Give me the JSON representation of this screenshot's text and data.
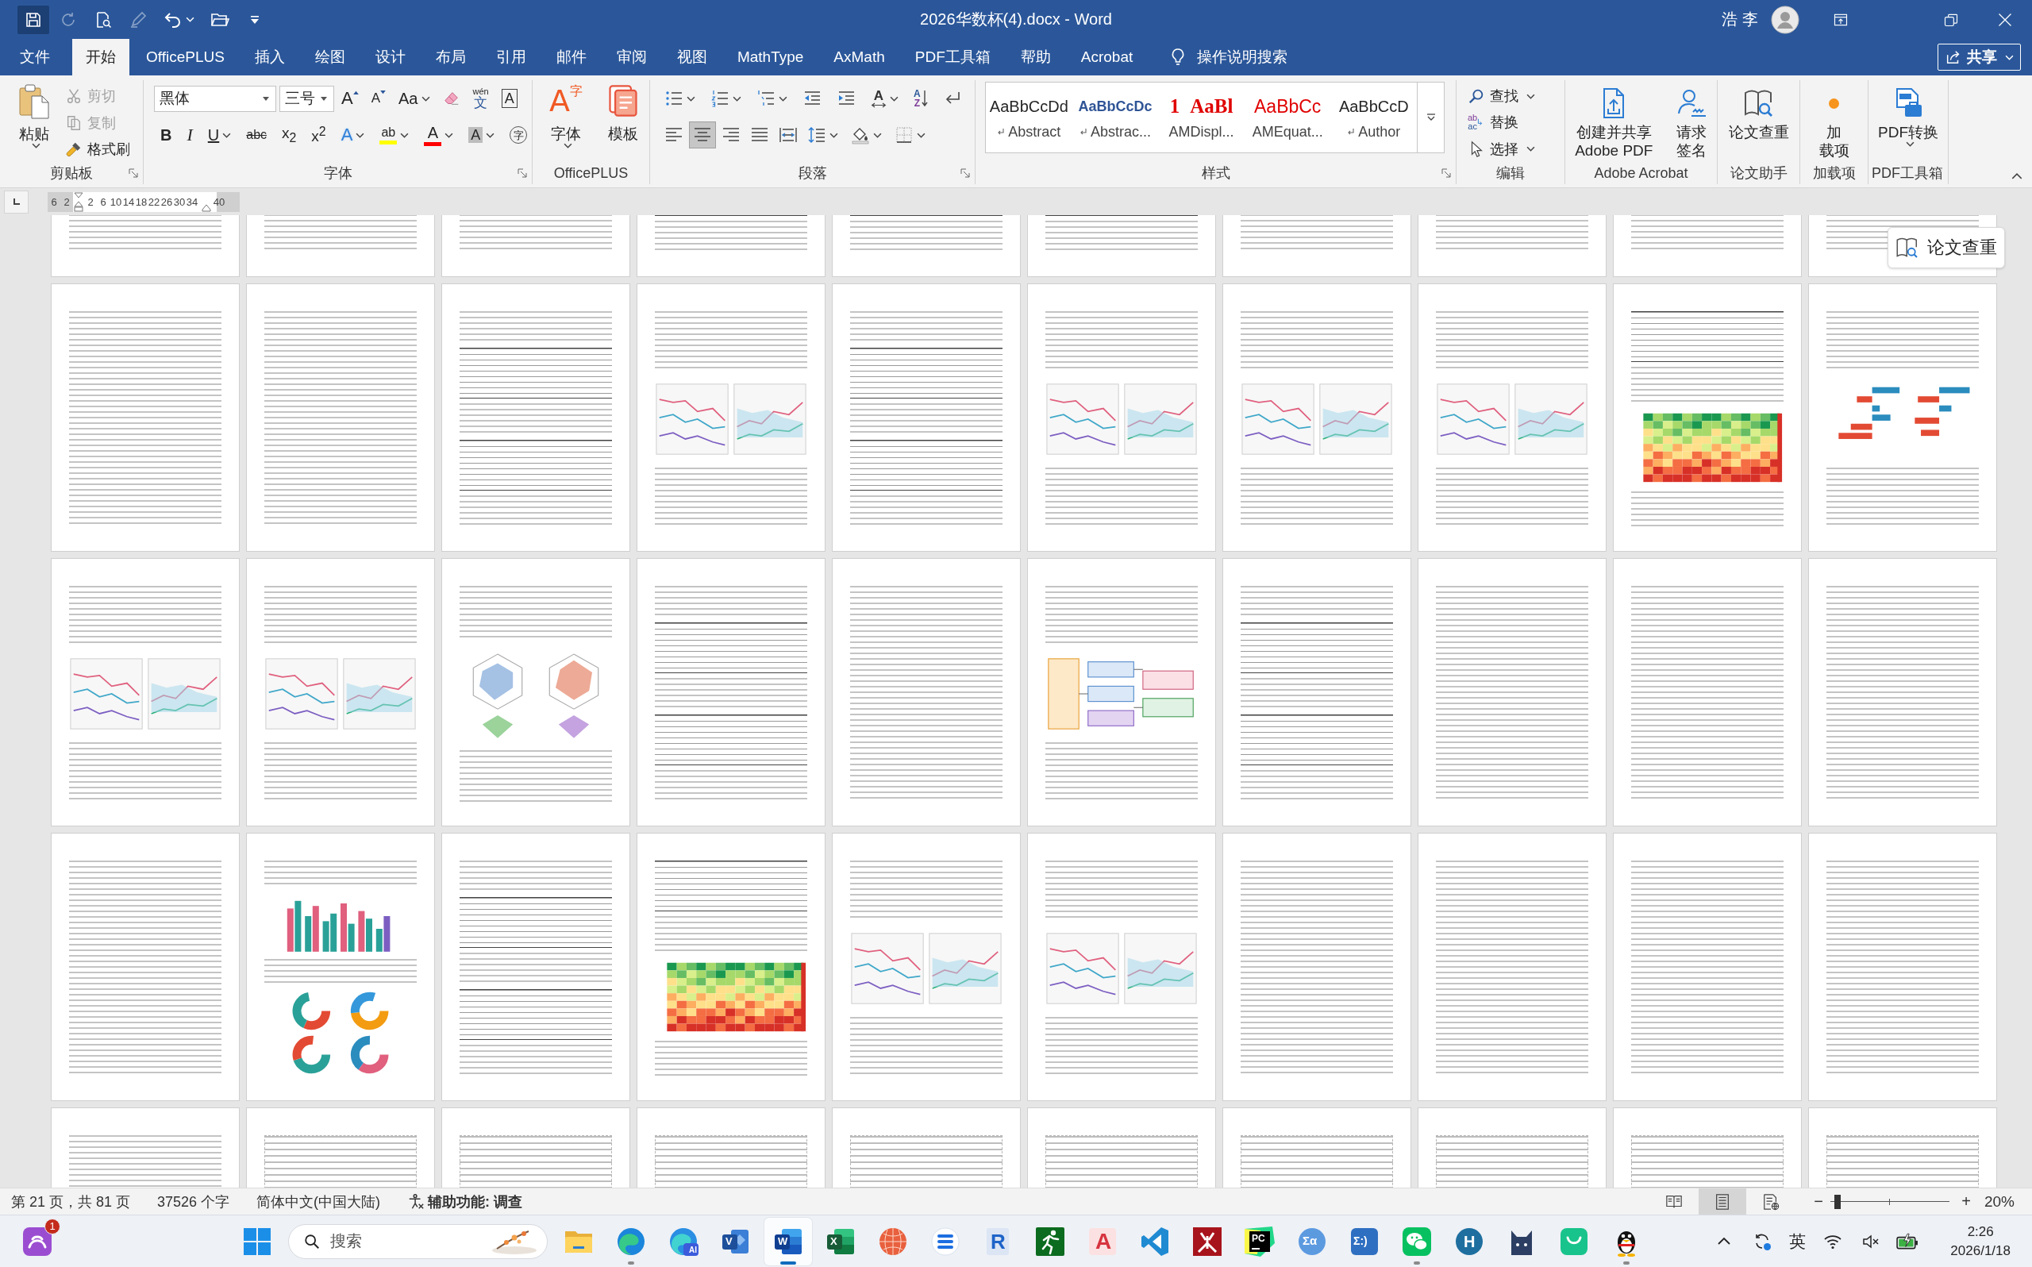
{
  "title_bar": {
    "quick_access": [
      {
        "kind": "save",
        "highlighted": true,
        "disabled": false
      },
      {
        "kind": "autosave",
        "highlighted": false,
        "disabled": true
      },
      {
        "kind": "print_preview",
        "highlighted": false,
        "disabled": false
      },
      {
        "kind": "draw",
        "highlighted": false,
        "disabled": true
      },
      {
        "kind": "undo",
        "highlighted": false,
        "disabled": false
      },
      {
        "kind": "open",
        "highlighted": false,
        "disabled": false
      },
      {
        "kind": "customize",
        "highlighted": false,
        "disabled": false
      }
    ],
    "title": "2026华数杯(4).docx - Word",
    "user": "浩 李",
    "controls": [
      {
        "kind": "ribbon_options"
      },
      {
        "kind": "restore"
      },
      {
        "kind": "close"
      }
    ]
  },
  "tabs": [
    {
      "label": "文件",
      "selected": false
    },
    {
      "label": "开始",
      "selected": true
    },
    {
      "label": "OfficePLUS",
      "selected": false
    },
    {
      "label": "插入",
      "selected": false
    },
    {
      "label": "绘图",
      "selected": false
    },
    {
      "label": "设计",
      "selected": false
    },
    {
      "label": "布局",
      "selected": false
    },
    {
      "label": "引用",
      "selected": false
    },
    {
      "label": "邮件",
      "selected": false
    },
    {
      "label": "审阅",
      "selected": false
    },
    {
      "label": "视图",
      "selected": false
    },
    {
      "label": "MathType",
      "selected": false
    },
    {
      "label": "AxMath",
      "selected": false
    },
    {
      "label": "PDF工具箱",
      "selected": false
    },
    {
      "label": "帮助",
      "selected": false
    },
    {
      "label": "Acrobat",
      "selected": false
    }
  ],
  "tell_me": {
    "placeholder": "操作说明搜索"
  },
  "share": {
    "label": "共享"
  },
  "ribbon": {
    "groups": [
      {
        "kind": "clipboard",
        "label": "剪贴板",
        "paste": "粘贴",
        "items": [
          {
            "kind": "cut",
            "label": "剪切",
            "disabled": true
          },
          {
            "kind": "copy",
            "label": "复制",
            "disabled": true
          },
          {
            "kind": "format_painter",
            "label": "格式刷",
            "disabled": false
          }
        ]
      },
      {
        "kind": "font",
        "label": "字体",
        "font_name": "黑体",
        "font_size": "三号",
        "row1": [
          {
            "kind": "grow",
            "glyph": "A"
          },
          {
            "kind": "shrink",
            "glyph": "A"
          },
          {
            "kind": "case",
            "glyph": "Aa"
          },
          {
            "kind": "clear"
          },
          {
            "kind": "phonetic",
            "glyph": "文",
            "ruby": "wén"
          },
          {
            "kind": "char_border",
            "glyph": "A"
          }
        ],
        "row2": [
          {
            "kind": "bold",
            "glyph": "B"
          },
          {
            "kind": "italic",
            "glyph": "I"
          },
          {
            "kind": "underline",
            "glyph": "U"
          },
          {
            "kind": "strike",
            "glyph": "abc"
          },
          {
            "kind": "subscript",
            "glyph": "x$_{2}$"
          },
          {
            "kind": "superscript",
            "glyph": "x$^{2}$"
          },
          {
            "kind": "effects",
            "glyph": "A"
          },
          {
            "kind": "highlight",
            "glyph": "ab",
            "color": "#ffff00"
          },
          {
            "kind": "font_color",
            "glyph": "A",
            "color": "#ff0000"
          },
          {
            "kind": "shading",
            "glyph": "A"
          },
          {
            "kind": "enclose",
            "glyph": "字"
          }
        ]
      },
      {
        "kind": "officeplus",
        "label": "OfficePLUS",
        "buttons": [
          {
            "kind": "font",
            "label": "字体",
            "glyph": "A",
            "glyph_small": "字"
          },
          {
            "kind": "template",
            "label": "模板"
          }
        ]
      },
      {
        "kind": "paragraph",
        "label": "段落",
        "row1": [
          {
            "kind": "bullets"
          },
          {
            "kind": "numbering"
          },
          {
            "kind": "multilevel"
          },
          {
            "kind": "outdent"
          },
          {
            "kind": "indent"
          },
          {
            "kind": "asian_layout",
            "glyph": "A"
          },
          {
            "kind": "sort",
            "glyph": "A",
            "glyph2": "Z"
          },
          {
            "kind": "marks"
          }
        ],
        "alignment": [
          {
            "kind": "align_left",
            "selected": false
          },
          {
            "kind": "align_center",
            "selected": true
          },
          {
            "kind": "align_right",
            "selected": false
          },
          {
            "kind": "justify",
            "selected": false
          },
          {
            "kind": "distributed",
            "selected": false
          }
        ],
        "row2_tools": [
          {
            "kind": "line_spacing"
          },
          {
            "kind": "shading"
          },
          {
            "kind": "borders"
          }
        ]
      },
      {
        "kind": "styles",
        "label": "样式",
        "items": [
          {
            "kind": "plain",
            "preview": "AaBbCcDd",
            "name": "Abstract",
            "para_mark": true
          },
          {
            "kind": "heading",
            "preview": "AaBbCcDc",
            "name": "Abstrac...",
            "para_mark": true
          },
          {
            "kind": "display",
            "preview": "1 AaBl",
            "name": "AMDispl...",
            "para_mark": false
          },
          {
            "kind": "equation",
            "preview": "AaBbCc",
            "name": "AMEquat...",
            "para_mark": false
          },
          {
            "kind": "plain",
            "preview": "AaBbCcD",
            "name": "Author",
            "para_mark": true
          }
        ]
      },
      {
        "kind": "editing",
        "label": "编辑",
        "items": [
          {
            "kind": "find",
            "label": "查找"
          },
          {
            "kind": "replace",
            "label": "替换",
            "glyph": "ab",
            "glyph2": "ac"
          },
          {
            "kind": "select",
            "label": "选择"
          }
        ]
      },
      {
        "kind": "big_buttons",
        "label": "Adobe Acrobat",
        "buttons": [
          {
            "kind": "create_pdf",
            "lines": [
              "创建并共享",
              "Adobe PDF"
            ]
          },
          {
            "kind": "request_sign",
            "lines": [
              "请求",
              "签名"
            ]
          }
        ]
      },
      {
        "kind": "big_buttons",
        "label": "论文助手",
        "buttons": [
          {
            "kind": "plagiarism",
            "lines": [
              "论文查重"
            ]
          }
        ]
      },
      {
        "kind": "big_buttons",
        "label": "加载项",
        "buttons": [
          {
            "kind": "addins",
            "lines": [
              "加",
              "载项"
            ]
          }
        ]
      },
      {
        "kind": "big_buttons",
        "label": "PDF工具箱",
        "buttons": [
          {
            "kind": "pdf_convert",
            "lines": [
              "PDF转换"
            ]
          }
        ]
      }
    ]
  },
  "ruler": {
    "numbers": [
      "6",
      "2",
      "2",
      "6",
      "10",
      "14",
      "18",
      "22",
      "26",
      "30",
      "34",
      "40"
    ]
  },
  "float_button": {
    "label": "论文查重"
  },
  "status_bar": {
    "items": [
      {
        "kind": "page",
        "text": "第 21 页，共 81 页"
      },
      {
        "kind": "words",
        "text": "37526 个字"
      },
      {
        "kind": "language",
        "text": "简体中文(中国大陆)"
      },
      {
        "kind": "accessibility",
        "text": "辅助功能: 调查"
      }
    ],
    "views": [
      {
        "kind": "read",
        "selected": false
      },
      {
        "kind": "print",
        "selected": true
      },
      {
        "kind": "web",
        "selected": false
      }
    ],
    "zoom_out": "−",
    "zoom": {
      "level": 0.06
    },
    "zoom_in": "+",
    "zoom_reading": "20%"
  },
  "taskbar": {
    "widget": {
      "badge": "1"
    },
    "search": {
      "placeholder": "搜索"
    },
    "apps": [
      {
        "kind": "explorer",
        "running": false,
        "selected": false
      },
      {
        "kind": "edge",
        "running": true,
        "selected": false
      },
      {
        "kind": "edge_ai",
        "glyph": "AI",
        "running": false,
        "selected": false
      },
      {
        "kind": "visio",
        "glyph": "V",
        "running": false,
        "selected": false
      },
      {
        "kind": "word",
        "glyph": "W",
        "running": true,
        "selected": true
      },
      {
        "kind": "excel",
        "glyph": "X",
        "running": false,
        "selected": false
      },
      {
        "kind": "sphere",
        "running": false,
        "selected": false
      },
      {
        "kind": "stripes",
        "running": false,
        "selected": false
      },
      {
        "kind": "r_app",
        "glyph": "R",
        "running": false,
        "selected": false
      },
      {
        "kind": "runner",
        "running": false,
        "selected": false
      },
      {
        "kind": "cad",
        "glyph": "A",
        "running": false,
        "selected": false
      },
      {
        "kind": "vscode",
        "running": false,
        "selected": false
      },
      {
        "kind": "flame",
        "running": false,
        "selected": false
      },
      {
        "kind": "pycharm",
        "glyph": "PC",
        "running": false,
        "selected": false
      },
      {
        "kind": "sigma_alpha",
        "glyph": "Σα",
        "running": false,
        "selected": false
      },
      {
        "kind": "sigma_smile",
        "glyph": "Σ:)",
        "running": false,
        "selected": false
      },
      {
        "kind": "wechat",
        "running": true,
        "selected": false
      },
      {
        "kind": "h_app",
        "glyph": "H",
        "running": false,
        "selected": false
      },
      {
        "kind": "cat",
        "running": false,
        "selected": false
      },
      {
        "kind": "bag",
        "running": false,
        "selected": false
      },
      {
        "kind": "qq",
        "running": true,
        "selected": false
      }
    ],
    "tray": {
      "ime": "英",
      "time": "2:26",
      "date": "2026/1/18"
    }
  }
}
